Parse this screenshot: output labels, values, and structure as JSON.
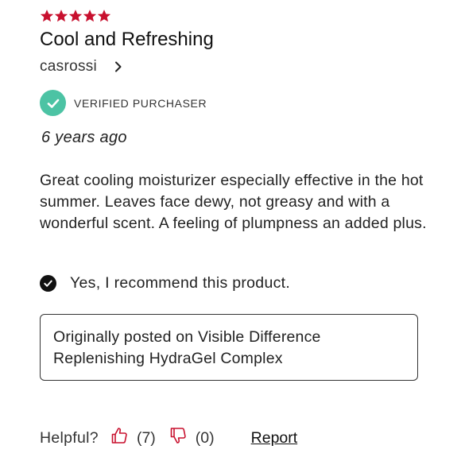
{
  "review": {
    "rating": 5,
    "rating_max": 5,
    "star_color": "#c8102e",
    "title": "Cool and Refreshing",
    "author": "casrossi",
    "verified_label": "VERIFIED PURCHASER",
    "verified_color": "#4cc3a4",
    "date": "6 years ago",
    "body": "Great cooling moisturizer especially effective in the hot summer. Leaves face dewy, not greasy and with a wonderful scent. A feeling of plumpness an added plus.",
    "recommend_text": "Yes, I recommend this product.",
    "origin_text": "Originally posted on Visible Difference Replenishing HydraGel Complex"
  },
  "feedback": {
    "helpful_label": "Helpful?",
    "up_count": "(7)",
    "down_count": "(0)",
    "report_label": "Report"
  },
  "icons": {
    "stars": "star-icon",
    "chevron": "chevron-right-icon",
    "verified": "check-circle-icon",
    "recommend": "check-circle-icon",
    "thumbs_up": "thumbs-up-icon",
    "thumbs_down": "thumbs-down-icon"
  }
}
